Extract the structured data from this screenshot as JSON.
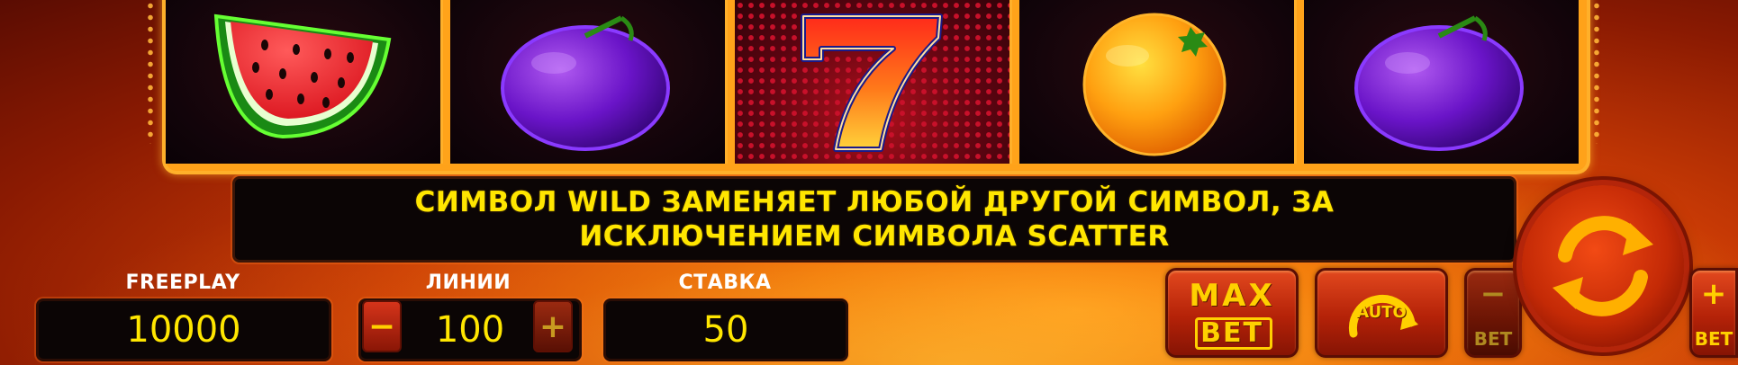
{
  "reels": [
    {
      "symbol": "watermelon-icon"
    },
    {
      "symbol": "plum-icon"
    },
    {
      "symbol": "seven-icon",
      "label": "7"
    },
    {
      "symbol": "orange-icon"
    },
    {
      "symbol": "plum-icon"
    }
  ],
  "message": {
    "line1": "СИМВОЛ WILD ЗАМЕНЯЕТ ЛЮБОЙ ДРУГОЙ СИМВОЛ, ЗА",
    "line2": "ИСКЛЮЧЕНИЕМ СИМВОЛА SCATTER"
  },
  "freeplay": {
    "label": "FREEPLAY",
    "value": "10000"
  },
  "lines": {
    "label": "ЛИНИИ",
    "value": "100",
    "minus": "−",
    "plus": "+"
  },
  "stake": {
    "label": "СТАВКА",
    "value": "50"
  },
  "buttons": {
    "max_bet_line1": "MAX",
    "max_bet_line2": "BET",
    "auto": "AUTO",
    "bet_minus_sign": "−",
    "bet_minus_label": "BET",
    "bet_plus_sign": "+",
    "bet_plus_label": "BET"
  },
  "colors": {
    "accent_yellow": "#ffe600",
    "frame_gold": "#ffb02a",
    "panel_black": "#0b0505",
    "button_red": "#c42a06"
  }
}
